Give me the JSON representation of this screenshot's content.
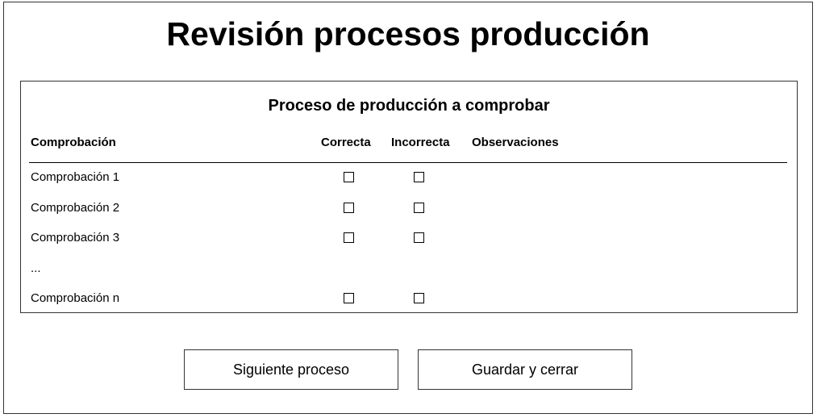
{
  "header": {
    "title": "Revisión procesos producción"
  },
  "panel": {
    "title": "Proceso de producción a comprobar",
    "columns": {
      "check": "Comprobación",
      "correct": "Correcta",
      "incorrect": "Incorrecta",
      "observations": "Observaciones"
    },
    "rows": [
      {
        "label": "Comprobación 1",
        "has_checkboxes": true,
        "correct_checked": false,
        "incorrect_checked": false
      },
      {
        "label": "Comprobación 2",
        "has_checkboxes": true,
        "correct_checked": false,
        "incorrect_checked": false
      },
      {
        "label": "Comprobación 3",
        "has_checkboxes": true,
        "correct_checked": false,
        "incorrect_checked": false
      },
      {
        "label": "...",
        "has_checkboxes": false
      },
      {
        "label": "Comprobación n",
        "has_checkboxes": true,
        "correct_checked": false,
        "incorrect_checked": false
      }
    ]
  },
  "actions": {
    "next_label": "Siguiente proceso",
    "save_label": "Guardar y cerrar"
  },
  "colors": {
    "border": "#333333",
    "text": "#000000",
    "background": "#ffffff"
  }
}
